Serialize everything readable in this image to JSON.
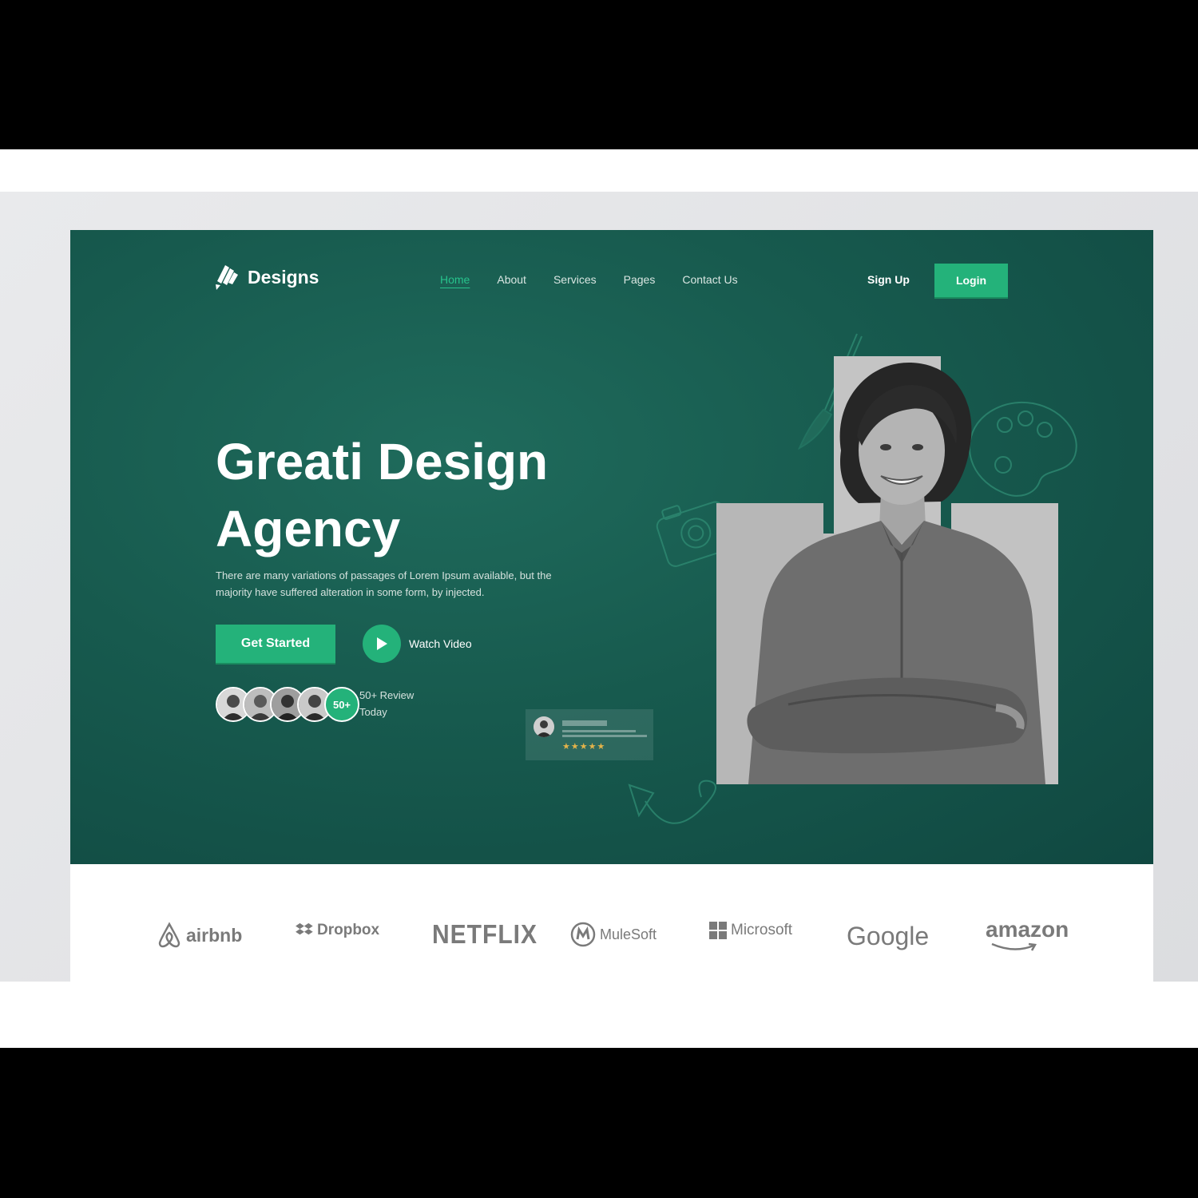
{
  "brand": {
    "name": "Designs"
  },
  "nav": {
    "items": [
      {
        "label": "Home",
        "active": true
      },
      {
        "label": "About",
        "active": false
      },
      {
        "label": "Services",
        "active": false
      },
      {
        "label": "Pages",
        "active": false
      },
      {
        "label": "Contact Us",
        "active": false
      }
    ],
    "signup_label": "Sign Up",
    "login_label": "Login"
  },
  "hero": {
    "title_line1": "Greati Design",
    "title_line2": "Agency",
    "description_line1": "There are many variations of passages of Lorem Ipsum available, but the",
    "description_line2": "majority have suffered alteration in some form, by injected.",
    "cta_label": "Get Started",
    "watch_label": "Watch Video",
    "review_count_badge": "50+",
    "review_line1": "50+ Review",
    "review_line2": "Today",
    "review_card_rating": 5
  },
  "logos": [
    "airbnb",
    "Dropbox",
    "NETFLIX",
    "MuleSoft",
    "Microsoft",
    "Google",
    "amazon"
  ],
  "colors": {
    "hero_bg": "#175a4e",
    "accent": "#24b27a",
    "logo_gray": "#7a7a7a"
  }
}
